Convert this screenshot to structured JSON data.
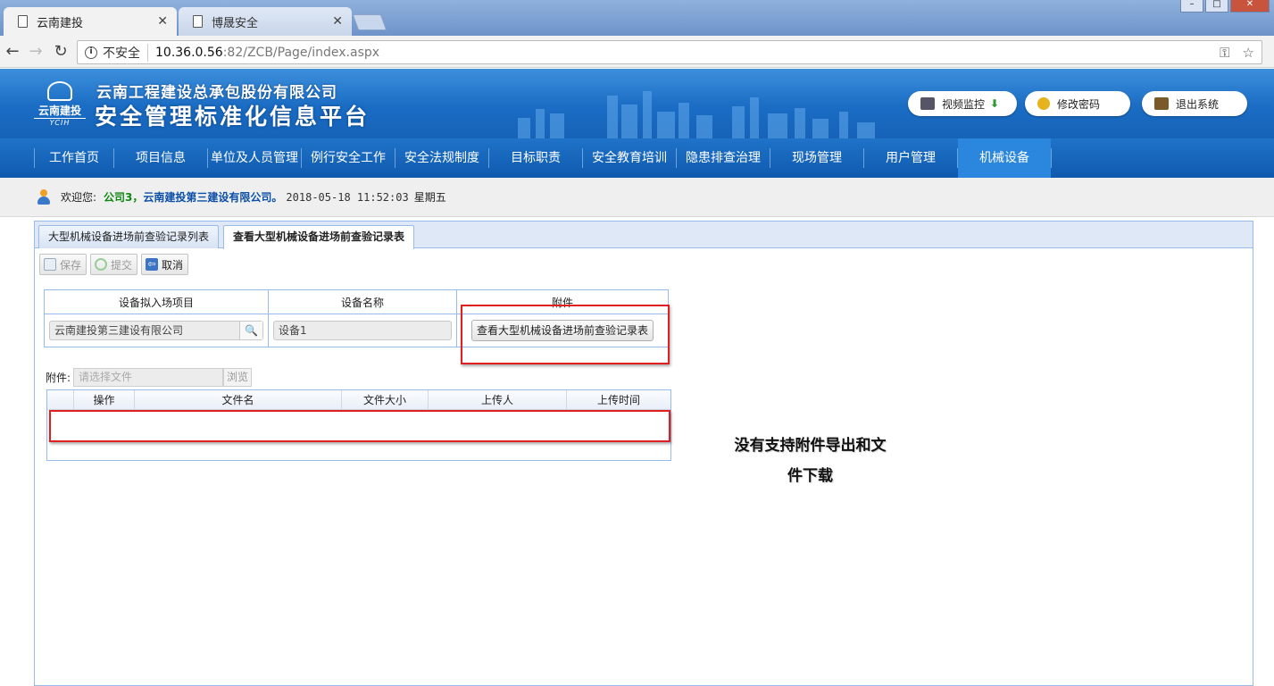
{
  "browser": {
    "tabs": [
      {
        "title": "云南建投",
        "close": "✕"
      },
      {
        "title": "博晟安全",
        "close": "✕"
      }
    ],
    "security_label": "不安全",
    "url_host": "10.36.0.56",
    "url_path": ":82/ZCB/Page/index.aspx"
  },
  "header": {
    "logo_abbr": "云南建投",
    "logo_eng": "YCIH",
    "company": "云南工程建设总承包股份有限公司",
    "platform": "安全管理标准化信息平台",
    "buttons": {
      "video": "视频监控",
      "password": "修改密码",
      "logout": "退出系统"
    }
  },
  "menu": [
    "工作首页",
    "项目信息",
    "单位及人员管理",
    "例行安全工作",
    "安全法规制度",
    "目标职责",
    "安全教育培训",
    "隐患排查治理",
    "现场管理",
    "用户管理",
    "机械设备"
  ],
  "menu_active": "机械设备",
  "welcome": {
    "greeting": "欢迎您:",
    "user": "公司3，",
    "org": "云南建投第三建设有限公司。",
    "datetime": "2018-05-18 11:52:03",
    "weekday": "星期五"
  },
  "panel": {
    "tabs": [
      "大型机械设备进场前查验记录列表",
      "查看大型机械设备进场前查验记录表"
    ],
    "toolbar": {
      "save": "保存",
      "submit": "提交",
      "cancel": "取消"
    },
    "form": {
      "headers": [
        "设备拟入场项目",
        "设备名称",
        "附件"
      ],
      "project_value": "云南建投第三建设有限公司",
      "equipment_value": "设备1",
      "attachment_button": "查看大型机械设备进场前查验记录表"
    },
    "attach": {
      "label": "附件:",
      "placeholder": "请选择文件",
      "browse": "浏览"
    },
    "grid": {
      "columns": [
        "",
        "操作",
        "文件名",
        "文件大小",
        "上传人",
        "上传时间"
      ]
    }
  },
  "annotation": {
    "line1": "没有支持附件导出和文",
    "line2": "件下载"
  }
}
